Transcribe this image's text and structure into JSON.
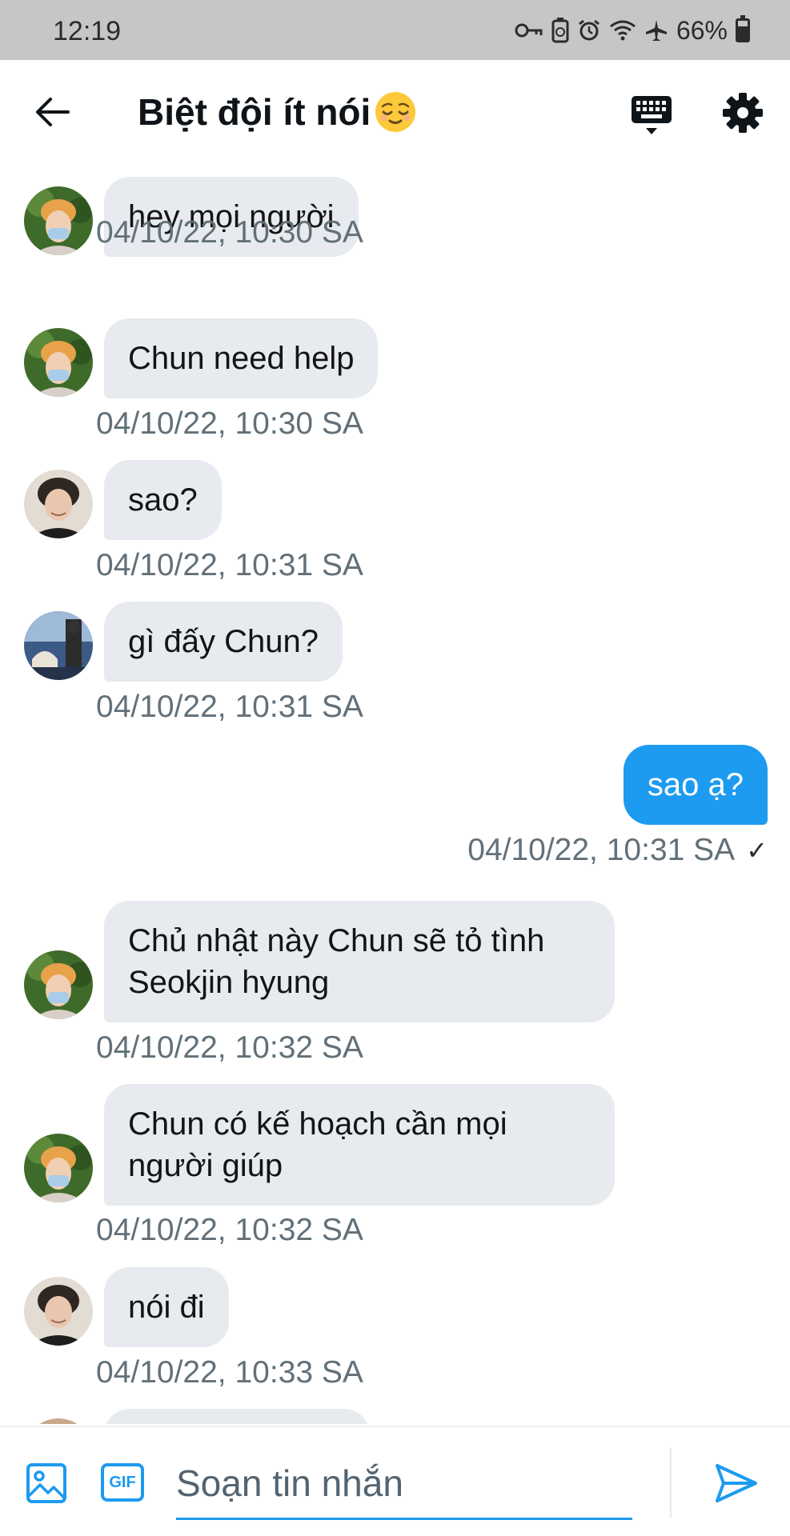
{
  "status_bar": {
    "time": "12:19",
    "battery_percent": "66%",
    "icons": [
      "vpn-key-icon",
      "battery-saver-icon",
      "alarm-icon",
      "wifi-icon",
      "airplane-icon",
      "battery-icon"
    ]
  },
  "header": {
    "title": "Biệt đội ít nói",
    "title_emoji": "relieved-face-emoji"
  },
  "messages": [
    {
      "text": "hey mọi người",
      "time": "04/10/22, 10:30 SA",
      "direction": "in",
      "avatar": "avatar-orange-hair"
    },
    {
      "text": "Chun need help",
      "time": "04/10/22, 10:30 SA",
      "direction": "in",
      "avatar": "avatar-orange-hair"
    },
    {
      "text": "sao?",
      "time": "04/10/22, 10:31 SA",
      "direction": "in",
      "avatar": "avatar-dark-hair"
    },
    {
      "text": "gì đấy Chun?",
      "time": "04/10/22, 10:31 SA",
      "direction": "in",
      "avatar": "avatar-photo-scene"
    },
    {
      "text": "sao ạ?",
      "time": "04/10/22, 10:31 SA",
      "direction": "out",
      "status": "✓"
    },
    {
      "text": "Chủ nhật này Chun sẽ tỏ tình Seokjin hyung",
      "time": "04/10/22, 10:32 SA",
      "direction": "in",
      "avatar": "avatar-orange-hair"
    },
    {
      "text": "Chun có kế hoạch cần mọi người giúp",
      "time": "04/10/22, 10:32 SA",
      "direction": "in",
      "avatar": "avatar-orange-hair"
    },
    {
      "text": "nói đi",
      "time": "04/10/22, 10:33 SA",
      "direction": "in",
      "avatar": "avatar-dark-hair"
    }
  ],
  "compose": {
    "placeholder": "Soạn tin nhắn",
    "gif_label": "GIF"
  },
  "colors": {
    "accent": "#1d9bf0",
    "bubble_in": "#e7ebef",
    "timestamp": "#627079",
    "status_bar": "#c6c6c6"
  }
}
